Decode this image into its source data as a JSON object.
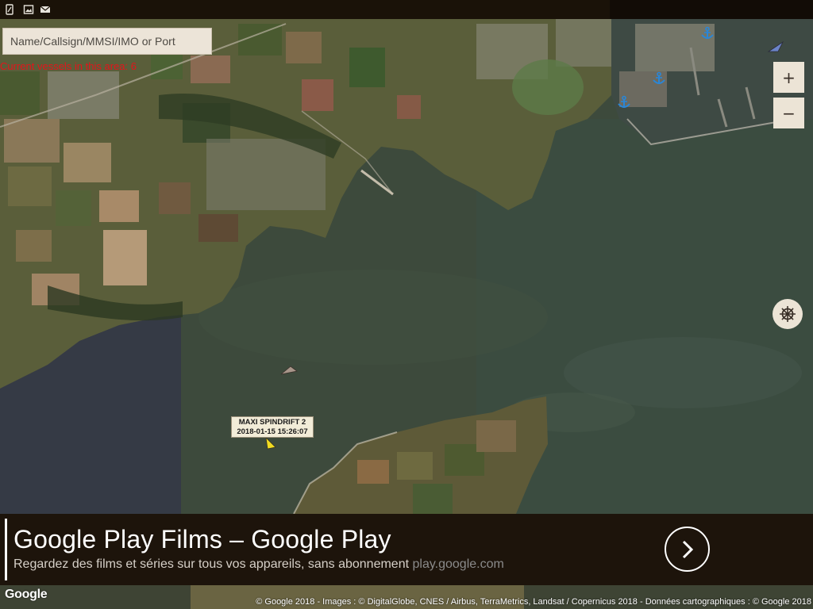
{
  "search": {
    "placeholder": "Name/Callsign/MMSI/IMO or Port"
  },
  "status": {
    "vessel_count_text": "Current vessels in this area: 6"
  },
  "map_controls": {
    "zoom_in_label": "+",
    "zoom_out_label": "−"
  },
  "vessel_label": {
    "name": "MAXI SPINDRIFT 2",
    "timestamp": "2018-01-15 15:26:07"
  },
  "ad": {
    "title": "Google Play Films – Google Play",
    "description": "Regardez des films et séries sur tous vos appareils, sans abonnement",
    "url": "play.google.com"
  },
  "footer": {
    "google_logo": "Google",
    "attribution": "© Google 2018 - Images : © DigitalGlobe, CNES / Airbus, TerraMetrics, Landsat / Copernicus 2018 - Données cartographiques : © Google 2018"
  },
  "icons": {
    "status": [
      "phone-icon",
      "image-icon",
      "mail-icon"
    ],
    "map": [
      "anchor-icon",
      "helm-icon",
      "chevron-right-icon",
      "vessel-marker-icon"
    ]
  },
  "colors": {
    "vessel_count": "#e4141a",
    "ad_background": "#1d140b",
    "control_background": "#ece4d6",
    "vessel_selected": "#f2dc22",
    "vessel_blue": "#6b84c8",
    "vessel_gray": "#a8968a",
    "anchor": "#2a86d6"
  }
}
